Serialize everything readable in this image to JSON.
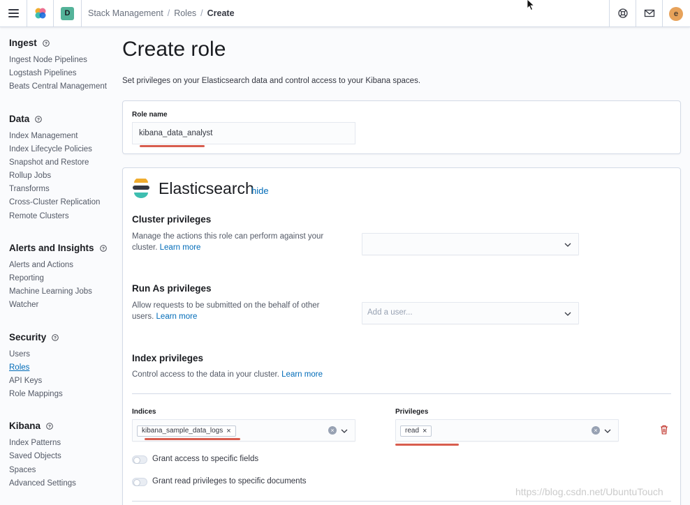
{
  "header": {
    "space_initial": "D",
    "breadcrumbs": [
      "Stack Management",
      "Roles",
      "Create"
    ],
    "avatar_initial": "e"
  },
  "sidebar": {
    "groups": [
      {
        "title": "Ingest",
        "items": [
          "Ingest Node Pipelines",
          "Logstash Pipelines",
          "Beats Central Management"
        ]
      },
      {
        "title": "Data",
        "items": [
          "Index Management",
          "Index Lifecycle Policies",
          "Snapshot and Restore",
          "Rollup Jobs",
          "Transforms",
          "Cross-Cluster Replication",
          "Remote Clusters"
        ]
      },
      {
        "title": "Alerts and Insights",
        "items": [
          "Alerts and Actions",
          "Reporting",
          "Machine Learning Jobs",
          "Watcher"
        ]
      },
      {
        "title": "Security",
        "items": [
          "Users",
          "Roles",
          "API Keys",
          "Role Mappings"
        ]
      },
      {
        "title": "Kibana",
        "items": [
          "Index Patterns",
          "Saved Objects",
          "Spaces",
          "Advanced Settings"
        ]
      }
    ],
    "active_item": "Roles"
  },
  "main": {
    "title": "Create role",
    "description": "Set privileges on your Elasticsearch data and control access to your Kibana spaces.",
    "role_name": {
      "label": "Role name",
      "value": "kibana_data_analyst"
    },
    "elasticsearch": {
      "title": "Elasticsearch",
      "hide_label": "hide",
      "cluster": {
        "title": "Cluster privileges",
        "description": "Manage the actions this role can perform against your cluster.",
        "learn_more": "Learn more"
      },
      "run_as": {
        "title": "Run As privileges",
        "description": "Allow requests to be submitted on the behalf of other users.",
        "learn_more": "Learn more",
        "placeholder": "Add a user..."
      },
      "index": {
        "title": "Index privileges",
        "description": "Control access to the data in your cluster.",
        "learn_more": "Learn more",
        "indices_label": "Indices",
        "indices": [
          "kibana_sample_data_logs"
        ],
        "privileges_label": "Privileges",
        "privileges": [
          "read"
        ],
        "grant_fields": "Grant access to specific fields",
        "grant_documents": "Grant read privileges to specific documents"
      }
    }
  },
  "watermark": "https://blog.csdn.net/UbuntuTouch",
  "colors": {
    "accent": "#006bb8",
    "space_badge": "#54b399",
    "avatar": "#e7a25a",
    "annotation": "#d85d4e",
    "danger": "#bd271e"
  }
}
